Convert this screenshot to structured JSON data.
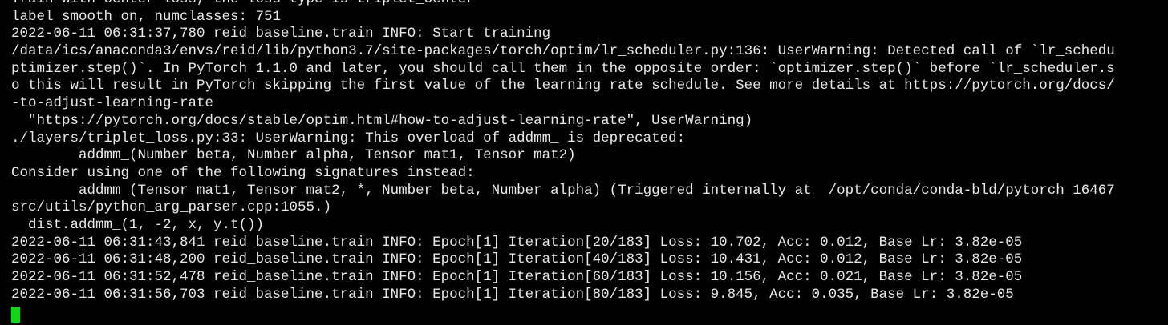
{
  "terminal": {
    "lines": [
      "Train with center loss, the loss type is triplet_center",
      "label smooth on, numclasses: 751",
      "2022-06-11 06:31:37,780 reid_baseline.train INFO: Start training",
      "/data/ics/anaconda3/envs/reid/lib/python3.7/site-packages/torch/optim/lr_scheduler.py:136: UserWarning: Detected call of `lr_schedu",
      "ptimizer.step()`. In PyTorch 1.1.0 and later, you should call them in the opposite order: `optimizer.step()` before `lr_scheduler.s",
      "o this will result in PyTorch skipping the first value of the learning rate schedule. See more details at https://pytorch.org/docs/",
      "-to-adjust-learning-rate",
      "  \"https://pytorch.org/docs/stable/optim.html#how-to-adjust-learning-rate\", UserWarning)",
      "./layers/triplet_loss.py:33: UserWarning: This overload of addmm_ is deprecated:",
      "        addmm_(Number beta, Number alpha, Tensor mat1, Tensor mat2)",
      "Consider using one of the following signatures instead:",
      "        addmm_(Tensor mat1, Tensor mat2, *, Number beta, Number alpha) (Triggered internally at  /opt/conda/conda-bld/pytorch_16467",
      "src/utils/python_arg_parser.cpp:1055.)",
      "  dist.addmm_(1, -2, x, y.t())",
      "2022-06-11 06:31:43,841 reid_baseline.train INFO: Epoch[1] Iteration[20/183] Loss: 10.702, Acc: 0.012, Base Lr: 3.82e-05",
      "2022-06-11 06:31:48,200 reid_baseline.train INFO: Epoch[1] Iteration[40/183] Loss: 10.431, Acc: 0.012, Base Lr: 3.82e-05",
      "2022-06-11 06:31:52,478 reid_baseline.train INFO: Epoch[1] Iteration[60/183] Loss: 10.156, Acc: 0.021, Base Lr: 3.82e-05",
      "2022-06-11 06:31:56,703 reid_baseline.train INFO: Epoch[1] Iteration[80/183] Loss: 9.845, Acc: 0.035, Base Lr: 3.82e-05"
    ],
    "colors": {
      "background": "#000000",
      "text": "#e8e8e8",
      "cursor": "#11d61a"
    }
  }
}
